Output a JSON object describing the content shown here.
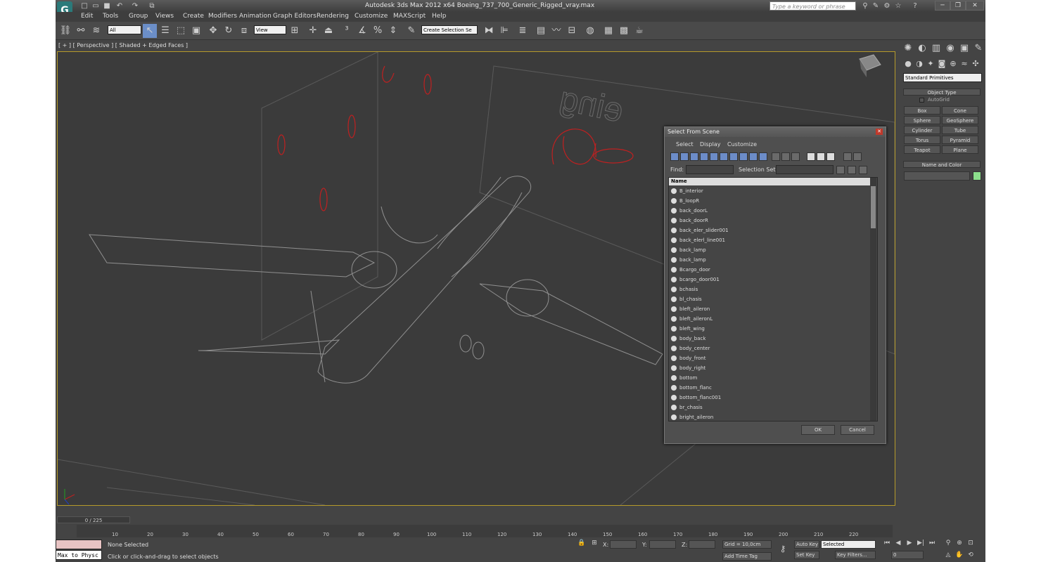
{
  "app": {
    "title": "Autodesk 3ds Max  2012 x64      Boeing_737_700_Generic_Rigged_vray.max",
    "search_placeholder": "Type a keyword or phrase"
  },
  "menu": [
    "Edit",
    "Tools",
    "Group",
    "Views",
    "Create",
    "Modifiers",
    "Animation",
    "Graph Editors",
    "Rendering",
    "Customize",
    "MAXScript",
    "Help"
  ],
  "toolbar": {
    "filter_value": "All",
    "view_value": "View",
    "selection_set": "Create Selection Se"
  },
  "viewport": {
    "label": "[ + ] [ Perspective ] [ Shaded + Edged Faces ]"
  },
  "command_panel": {
    "category": "Standard Primitives",
    "object_type_title": "Object Type",
    "autogrid": "AutoGrid",
    "primitives": [
      "Box",
      "Cone",
      "Sphere",
      "GeoSphere",
      "Cylinder",
      "Tube",
      "Torus",
      "Pyramid",
      "Teapot",
      "Plane"
    ],
    "name_color_title": "Name and Color"
  },
  "dialog": {
    "title": "Select From Scene",
    "menus": [
      "Select",
      "Display",
      "Customize"
    ],
    "find_label": "Find:",
    "selection_set_label": "Selection Set:",
    "column_header": "Name",
    "items": [
      "B_interior",
      "B_loopR",
      "back_doorL",
      "back_doorR",
      "back_eler_slider001",
      "back_elerl_line001",
      "back_lamp",
      "back_lamp",
      "Bcargo_door",
      "bcargo_door001",
      "bchasis",
      "bl_chasis",
      "bleft_aileron",
      "bleft_aileronL",
      "bleft_wing",
      "body_back",
      "body_center",
      "body_front",
      "body_right",
      "bottom",
      "bottom_flanc",
      "bottom_flanc001",
      "br_chasis",
      "bright_aileron"
    ],
    "ok": "OK",
    "cancel": "Cancel"
  },
  "timeline": {
    "position": "0 / 225",
    "ticks": [
      "10",
      "20",
      "30",
      "40",
      "50",
      "60",
      "70",
      "80",
      "90",
      "100",
      "110",
      "120",
      "130",
      "140",
      "150",
      "160",
      "170",
      "180",
      "190",
      "200",
      "210",
      "220"
    ]
  },
  "status": {
    "maxscript": "Max to Physc",
    "selection": "None Selected",
    "prompt": "Click or click-and-drag to select objects",
    "x_label": "X:",
    "y_label": "Y:",
    "z_label": "Z:",
    "grid": "Grid = 10,0cm",
    "add_time_tag": "Add Time Tag",
    "auto_key": "Auto Key",
    "auto_key_value": "Selected",
    "set_key": "Set Key",
    "key_filters": "Key Filters...",
    "frame": "0"
  }
}
